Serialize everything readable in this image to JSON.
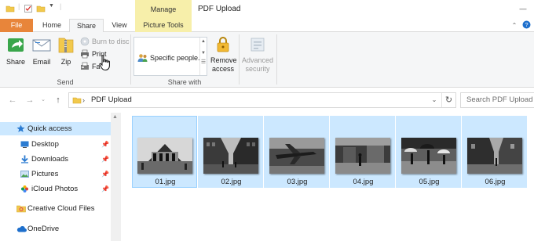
{
  "titlebar": {
    "manage_tab": "Manage",
    "title": "PDF Upload",
    "minimize_glyph": "—"
  },
  "tabs": {
    "file": "File",
    "home": "Home",
    "share": "Share",
    "view": "View",
    "picture_tools": "Picture Tools"
  },
  "ribbon": {
    "send": {
      "group_label": "Send",
      "share": "Share",
      "email": "Email",
      "zip": "Zip",
      "burn": "Burn to disc",
      "print": "Print",
      "fax": "Fa"
    },
    "share_with": {
      "group_label": "Share with",
      "specific_people": "Specific people...",
      "remove_access_line1": "Remove",
      "remove_access_line2": "access",
      "advanced_security_line1": "Advanced",
      "advanced_security_line2": "security"
    }
  },
  "address": {
    "path": "PDF Upload",
    "search_placeholder": "Search PDF Upload"
  },
  "nav": {
    "quick_access": "Quick access",
    "desktop": "Desktop",
    "downloads": "Downloads",
    "pictures": "Pictures",
    "icloud_photos": "iCloud Photos",
    "creative_cloud": "Creative Cloud Files",
    "onedrive": "OneDrive"
  },
  "files": [
    {
      "name": "01.jpg"
    },
    {
      "name": "02.jpg"
    },
    {
      "name": "03.jpg"
    },
    {
      "name": "04.jpg"
    },
    {
      "name": "05.jpg"
    },
    {
      "name": "06.jpg"
    }
  ],
  "colors": {
    "file_tab": "#e8853a",
    "contextual_tab": "#f7efaa",
    "selection": "#cce8ff",
    "ribbon_bg": "#f5f6f7"
  }
}
